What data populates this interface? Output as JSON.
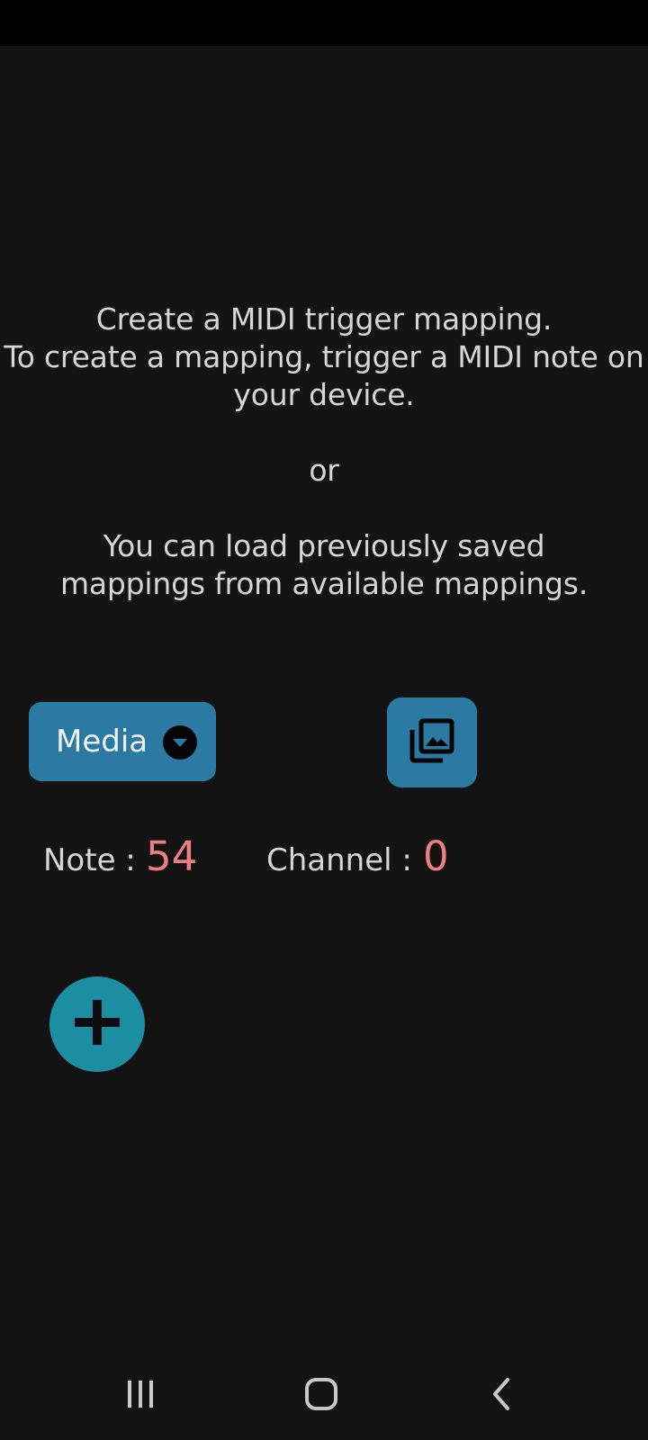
{
  "instructions": {
    "line1": "Create a MIDI trigger mapping.",
    "line2": "To create a mapping, trigger a MIDI note on your device.",
    "or": "or",
    "line3": "You can load previously saved mappings from available mappings."
  },
  "media_dropdown": {
    "selected": "Media",
    "icon": "caret-down-icon"
  },
  "gallery_button": {
    "icon": "photo-library-icon"
  },
  "note": {
    "label": "Note :",
    "value": "54"
  },
  "channel": {
    "label": "Channel :",
    "value": "0"
  },
  "add_button": {
    "icon": "plus-icon"
  },
  "nav": {
    "icons": [
      "recent-apps-icon",
      "home-icon",
      "back-icon"
    ]
  },
  "colors": {
    "background": "#131313",
    "accent": "#2a7aa3",
    "fab": "#1b8ea2",
    "value": "#ee7e86",
    "text": "#d6d6d6"
  }
}
